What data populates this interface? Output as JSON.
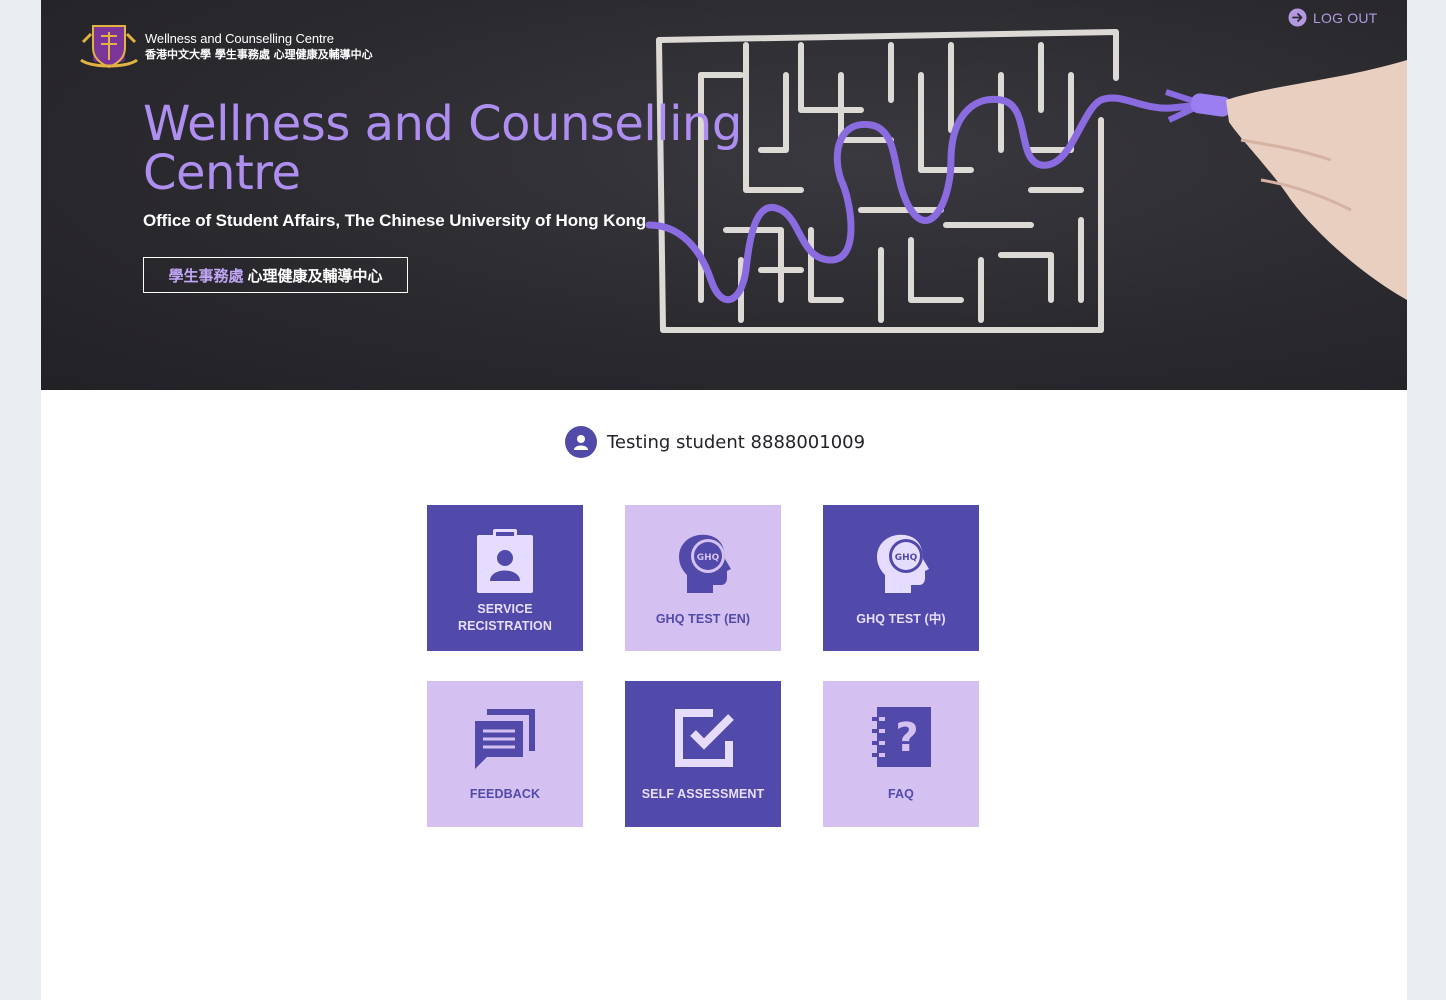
{
  "header": {
    "brand_en": "Wellness and Counselling Centre",
    "brand_zh": "香港中文大學 學生事務處 心理健康及輔導中心",
    "logout_label": "LOG OUT"
  },
  "hero": {
    "title": "Wellness and Counselling Centre",
    "subtitle": "Office of Student Affairs, The Chinese University of Hong Kong",
    "zh_label_a": "學生事務處",
    "zh_label_b": "心理健康及輔導中心"
  },
  "user": {
    "display_name": "Testing student 8888001009"
  },
  "tiles": [
    {
      "line1": "SERVICE",
      "line2": "RECISTRATION",
      "icon": "clipboard-person-icon",
      "style": "dark"
    },
    {
      "label": "GHQ TEST (EN)",
      "icon": "ghq-head-icon",
      "style": "light",
      "icon_text": "GHQ"
    },
    {
      "label": "GHQ TEST (中)",
      "icon": "ghq-head-icon",
      "style": "dark",
      "icon_text": "GHQ"
    },
    {
      "label": "FEEDBACK",
      "icon": "chat-bubbles-icon",
      "style": "light"
    },
    {
      "label": "SELF ASSESSMENT",
      "icon": "checkbox-icon",
      "style": "dark"
    },
    {
      "label": "FAQ",
      "icon": "question-notebook-icon",
      "style": "light"
    }
  ],
  "colors": {
    "accent_dark": "#514aaa",
    "accent_light": "#d4c1f1",
    "hero_title": "#ae8ff0",
    "background": "#eaeef3"
  }
}
